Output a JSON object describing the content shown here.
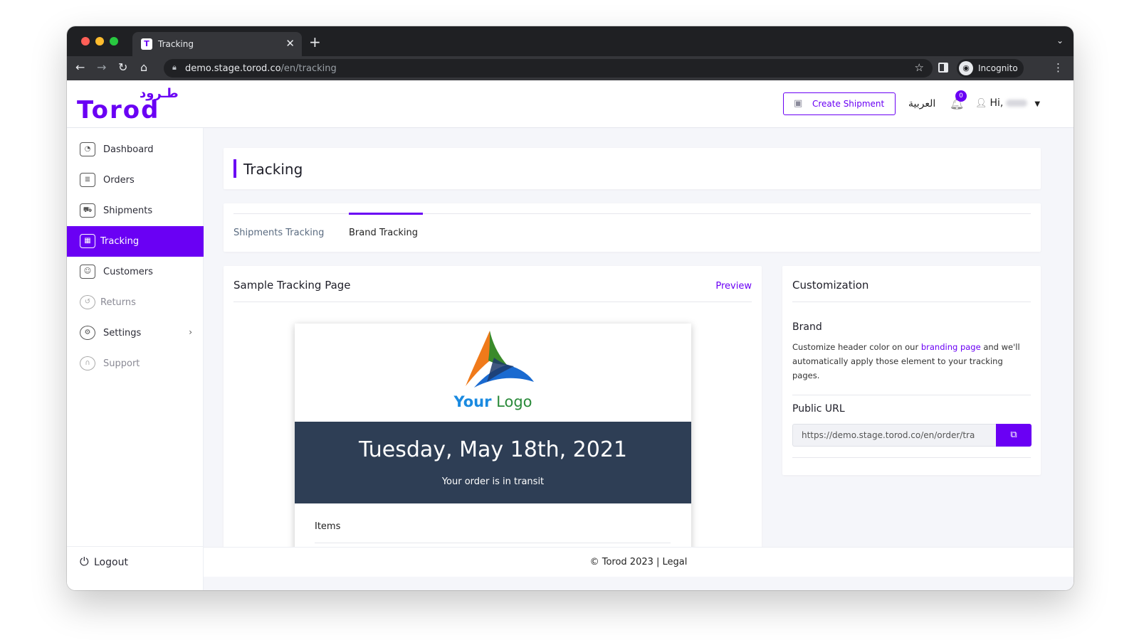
{
  "browser": {
    "tab_title": "Tracking",
    "tab_icon": "torod-favicon",
    "url_host": "demo.stage.torod.co",
    "url_path": "/en/tracking",
    "profile_label": "Incognito"
  },
  "header": {
    "logo_arabic": "طـرود",
    "logo_text": "Torod",
    "create_shipment_label": "Create Shipment",
    "language_label": "العربية",
    "notification_count": "0",
    "greeting": "Hi,"
  },
  "sidebar": {
    "items": [
      {
        "label": "Dashboard",
        "icon": "dashboard-icon"
      },
      {
        "label": "Orders",
        "icon": "orders-icon"
      },
      {
        "label": "Shipments",
        "icon": "shipments-icon"
      },
      {
        "label": "Tracking",
        "icon": "tracking-icon",
        "active": true
      },
      {
        "label": "Customers",
        "icon": "customers-icon"
      },
      {
        "label": "Returns",
        "icon": "returns-icon"
      },
      {
        "label": "Settings",
        "icon": "settings-icon"
      },
      {
        "label": "Support",
        "icon": "support-icon"
      }
    ],
    "logout_label": "Logout"
  },
  "page": {
    "title": "Tracking",
    "tabs": [
      {
        "label": "Shipments Tracking"
      },
      {
        "label": "Brand Tracking",
        "active": true
      }
    ]
  },
  "sample": {
    "title": "Sample Tracking Page",
    "preview_label": "Preview",
    "logo_your": "Your",
    "logo_logo": "Logo",
    "date": "Tuesday, May 18th, 2021",
    "status": "Your order is in transit",
    "items_label": "Items"
  },
  "customization": {
    "title": "Customization",
    "brand_heading": "Brand",
    "brand_text_before": "Customize header color on our ",
    "brand_link": "branding page",
    "brand_text_after": " and we'll automatically apply those element to your tracking pages.",
    "public_url_heading": "Public URL",
    "public_url_value": "https://demo.stage.torod.co/en/order/tra"
  },
  "footer": {
    "copyright": "© Torod 2023 |",
    "legal": "Legal"
  },
  "colors": {
    "accent": "#6a00f4",
    "banner": "#2e3e55"
  }
}
